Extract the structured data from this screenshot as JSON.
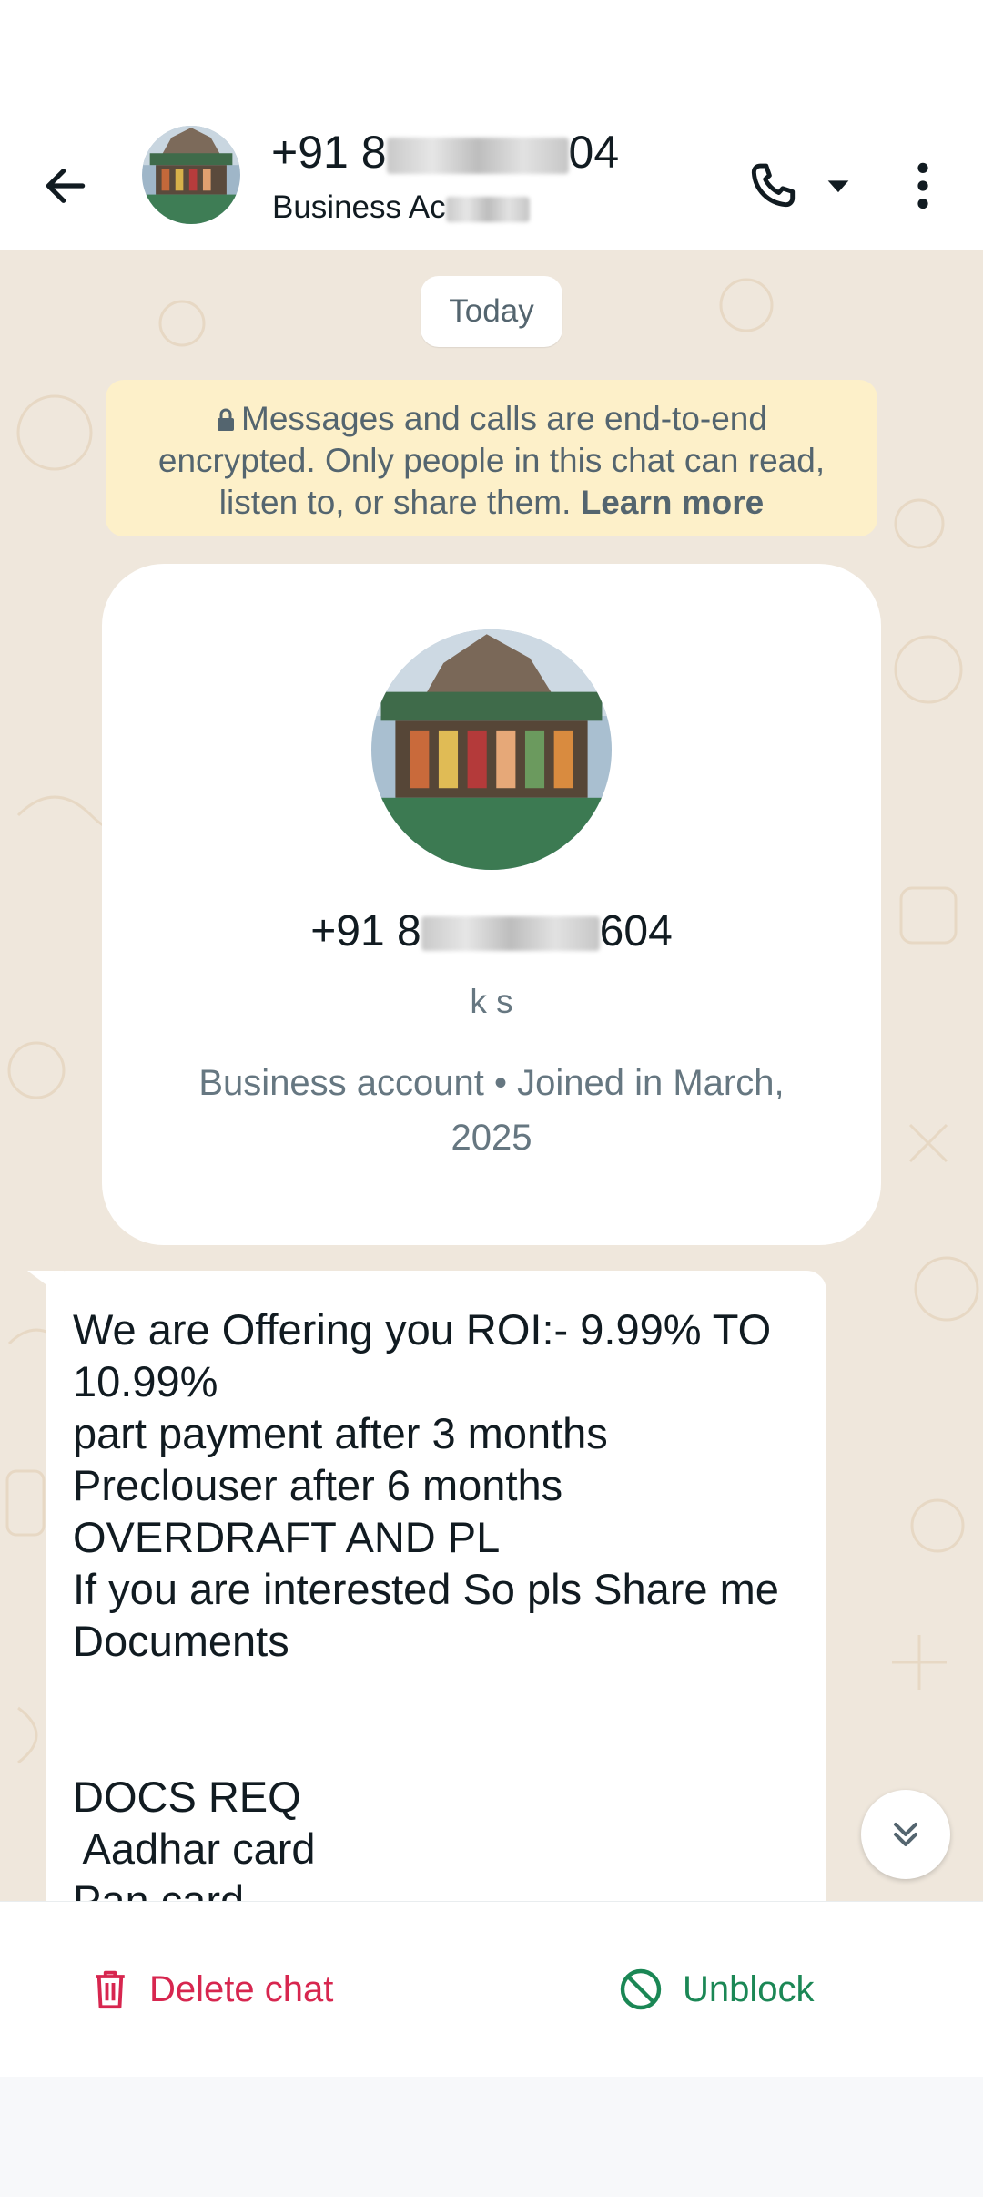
{
  "header": {
    "title_prefix": "+91 8",
    "title_suffix": "04",
    "subtitle_prefix": "Business Ac",
    "back_icon": "arrow-left-icon",
    "call_icon": "phone-icon",
    "dropdown_icon": "caret-down-icon",
    "menu_icon": "more-vertical-icon"
  },
  "chat": {
    "date_chip": "Today",
    "encryption_notice": {
      "text": "Messages and calls are end-to-end encrypted. Only people in this chat can read, listen to, or share them.",
      "link": "Learn more"
    },
    "profile_card": {
      "number_prefix": "+91 8",
      "number_suffix": "604",
      "name": "k s",
      "info": "Business account • Joined in March, 2025"
    },
    "message": {
      "lines": [
        "We are Offering you ROI:- 9.99% TO",
        "10.99%",
        "part payment after 3 months",
        "Preclouser after 6 months",
        "OVERDRAFT AND PL",
        "If you are interested So pls Share me",
        "Documents",
        "",
        "",
        "DOCS REQ",
        " Aadhar card",
        "Pan card"
      ]
    },
    "scroll_icon": "double-chevron-down-icon"
  },
  "actions": {
    "delete_label": "Delete chat",
    "unblock_label": "Unblock",
    "delete_color": "#d7264f",
    "unblock_color": "#1b8755"
  },
  "colors": {
    "chat_background": "#efe7dc",
    "notice_background": "#fdf0c9"
  }
}
